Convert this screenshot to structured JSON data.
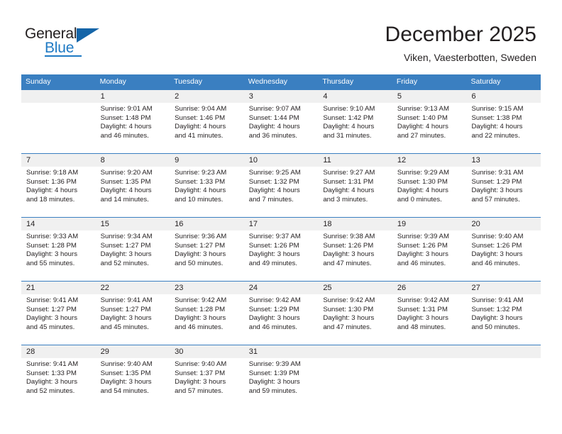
{
  "brand": {
    "name_part1": "General",
    "name_part2": "Blue",
    "triangle_color": "#1565a8",
    "accent_color": "#1f7ac4"
  },
  "header": {
    "title": "December 2025",
    "subtitle": "Viken, Vaesterbotten, Sweden"
  },
  "theme": {
    "header_row_bg": "#3a7fc1",
    "daynum_bg": "#f0f0f0",
    "text_color": "#231f20"
  },
  "weekdays": [
    "Sunday",
    "Monday",
    "Tuesday",
    "Wednesday",
    "Thursday",
    "Friday",
    "Saturday"
  ],
  "weeks": [
    {
      "days": [
        {
          "num": "",
          "l1": "",
          "l2": "",
          "l3": "",
          "l4": ""
        },
        {
          "num": "1",
          "l1": "Sunrise: 9:01 AM",
          "l2": "Sunset: 1:48 PM",
          "l3": "Daylight: 4 hours",
          "l4": "and 46 minutes."
        },
        {
          "num": "2",
          "l1": "Sunrise: 9:04 AM",
          "l2": "Sunset: 1:46 PM",
          "l3": "Daylight: 4 hours",
          "l4": "and 41 minutes."
        },
        {
          "num": "3",
          "l1": "Sunrise: 9:07 AM",
          "l2": "Sunset: 1:44 PM",
          "l3": "Daylight: 4 hours",
          "l4": "and 36 minutes."
        },
        {
          "num": "4",
          "l1": "Sunrise: 9:10 AM",
          "l2": "Sunset: 1:42 PM",
          "l3": "Daylight: 4 hours",
          "l4": "and 31 minutes."
        },
        {
          "num": "5",
          "l1": "Sunrise: 9:13 AM",
          "l2": "Sunset: 1:40 PM",
          "l3": "Daylight: 4 hours",
          "l4": "and 27 minutes."
        },
        {
          "num": "6",
          "l1": "Sunrise: 9:15 AM",
          "l2": "Sunset: 1:38 PM",
          "l3": "Daylight: 4 hours",
          "l4": "and 22 minutes."
        }
      ]
    },
    {
      "days": [
        {
          "num": "7",
          "l1": "Sunrise: 9:18 AM",
          "l2": "Sunset: 1:36 PM",
          "l3": "Daylight: 4 hours",
          "l4": "and 18 minutes."
        },
        {
          "num": "8",
          "l1": "Sunrise: 9:20 AM",
          "l2": "Sunset: 1:35 PM",
          "l3": "Daylight: 4 hours",
          "l4": "and 14 minutes."
        },
        {
          "num": "9",
          "l1": "Sunrise: 9:23 AM",
          "l2": "Sunset: 1:33 PM",
          "l3": "Daylight: 4 hours",
          "l4": "and 10 minutes."
        },
        {
          "num": "10",
          "l1": "Sunrise: 9:25 AM",
          "l2": "Sunset: 1:32 PM",
          "l3": "Daylight: 4 hours",
          "l4": "and 7 minutes."
        },
        {
          "num": "11",
          "l1": "Sunrise: 9:27 AM",
          "l2": "Sunset: 1:31 PM",
          "l3": "Daylight: 4 hours",
          "l4": "and 3 minutes."
        },
        {
          "num": "12",
          "l1": "Sunrise: 9:29 AM",
          "l2": "Sunset: 1:30 PM",
          "l3": "Daylight: 4 hours",
          "l4": "and 0 minutes."
        },
        {
          "num": "13",
          "l1": "Sunrise: 9:31 AM",
          "l2": "Sunset: 1:29 PM",
          "l3": "Daylight: 3 hours",
          "l4": "and 57 minutes."
        }
      ]
    },
    {
      "days": [
        {
          "num": "14",
          "l1": "Sunrise: 9:33 AM",
          "l2": "Sunset: 1:28 PM",
          "l3": "Daylight: 3 hours",
          "l4": "and 55 minutes."
        },
        {
          "num": "15",
          "l1": "Sunrise: 9:34 AM",
          "l2": "Sunset: 1:27 PM",
          "l3": "Daylight: 3 hours",
          "l4": "and 52 minutes."
        },
        {
          "num": "16",
          "l1": "Sunrise: 9:36 AM",
          "l2": "Sunset: 1:27 PM",
          "l3": "Daylight: 3 hours",
          "l4": "and 50 minutes."
        },
        {
          "num": "17",
          "l1": "Sunrise: 9:37 AM",
          "l2": "Sunset: 1:26 PM",
          "l3": "Daylight: 3 hours",
          "l4": "and 49 minutes."
        },
        {
          "num": "18",
          "l1": "Sunrise: 9:38 AM",
          "l2": "Sunset: 1:26 PM",
          "l3": "Daylight: 3 hours",
          "l4": "and 47 minutes."
        },
        {
          "num": "19",
          "l1": "Sunrise: 9:39 AM",
          "l2": "Sunset: 1:26 PM",
          "l3": "Daylight: 3 hours",
          "l4": "and 46 minutes."
        },
        {
          "num": "20",
          "l1": "Sunrise: 9:40 AM",
          "l2": "Sunset: 1:26 PM",
          "l3": "Daylight: 3 hours",
          "l4": "and 46 minutes."
        }
      ]
    },
    {
      "days": [
        {
          "num": "21",
          "l1": "Sunrise: 9:41 AM",
          "l2": "Sunset: 1:27 PM",
          "l3": "Daylight: 3 hours",
          "l4": "and 45 minutes."
        },
        {
          "num": "22",
          "l1": "Sunrise: 9:41 AM",
          "l2": "Sunset: 1:27 PM",
          "l3": "Daylight: 3 hours",
          "l4": "and 45 minutes."
        },
        {
          "num": "23",
          "l1": "Sunrise: 9:42 AM",
          "l2": "Sunset: 1:28 PM",
          "l3": "Daylight: 3 hours",
          "l4": "and 46 minutes."
        },
        {
          "num": "24",
          "l1": "Sunrise: 9:42 AM",
          "l2": "Sunset: 1:29 PM",
          "l3": "Daylight: 3 hours",
          "l4": "and 46 minutes."
        },
        {
          "num": "25",
          "l1": "Sunrise: 9:42 AM",
          "l2": "Sunset: 1:30 PM",
          "l3": "Daylight: 3 hours",
          "l4": "and 47 minutes."
        },
        {
          "num": "26",
          "l1": "Sunrise: 9:42 AM",
          "l2": "Sunset: 1:31 PM",
          "l3": "Daylight: 3 hours",
          "l4": "and 48 minutes."
        },
        {
          "num": "27",
          "l1": "Sunrise: 9:41 AM",
          "l2": "Sunset: 1:32 PM",
          "l3": "Daylight: 3 hours",
          "l4": "and 50 minutes."
        }
      ]
    },
    {
      "days": [
        {
          "num": "28",
          "l1": "Sunrise: 9:41 AM",
          "l2": "Sunset: 1:33 PM",
          "l3": "Daylight: 3 hours",
          "l4": "and 52 minutes."
        },
        {
          "num": "29",
          "l1": "Sunrise: 9:40 AM",
          "l2": "Sunset: 1:35 PM",
          "l3": "Daylight: 3 hours",
          "l4": "and 54 minutes."
        },
        {
          "num": "30",
          "l1": "Sunrise: 9:40 AM",
          "l2": "Sunset: 1:37 PM",
          "l3": "Daylight: 3 hours",
          "l4": "and 57 minutes."
        },
        {
          "num": "31",
          "l1": "Sunrise: 9:39 AM",
          "l2": "Sunset: 1:39 PM",
          "l3": "Daylight: 3 hours",
          "l4": "and 59 minutes."
        },
        {
          "num": "",
          "l1": "",
          "l2": "",
          "l3": "",
          "l4": ""
        },
        {
          "num": "",
          "l1": "",
          "l2": "",
          "l3": "",
          "l4": ""
        },
        {
          "num": "",
          "l1": "",
          "l2": "",
          "l3": "",
          "l4": ""
        }
      ]
    }
  ]
}
